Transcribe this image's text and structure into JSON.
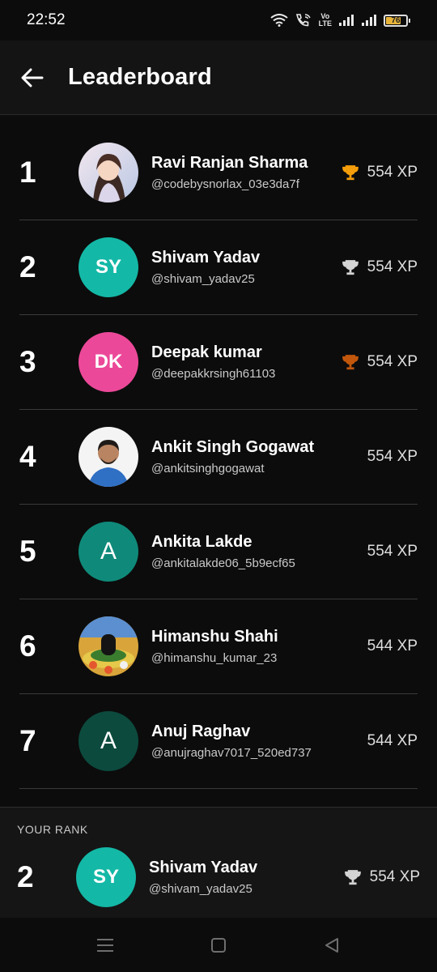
{
  "status_bar": {
    "time": "22:52",
    "volte_top": "Vo",
    "volte_bottom": "LTE",
    "battery": "76",
    "battery_level_percent": 76,
    "battery_color": "#e8b43a"
  },
  "app_bar": {
    "title": "Leaderboard",
    "back_icon": "arrow-left-icon"
  },
  "leaders": [
    {
      "rank": "1",
      "name": "Ravi Ranjan Sharma",
      "handle": "@codebysnorlax_03e3da7f",
      "xp": "554 XP",
      "avatar": "photo",
      "trophy": "gold"
    },
    {
      "rank": "2",
      "name": "Shivam Yadav",
      "handle": "@shivam_yadav25",
      "xp": "554 XP",
      "avatar": "SY",
      "avatar_color": "#14b8a6",
      "trophy": "silver"
    },
    {
      "rank": "3",
      "name": "Deepak kumar",
      "handle": "@deepakkrsingh61103",
      "xp": "554 XP",
      "avatar": "DK",
      "avatar_color": "#ec4899",
      "trophy": "bronze"
    },
    {
      "rank": "4",
      "name": "Ankit Singh Gogawat",
      "handle": "@ankitsinghgogawat",
      "xp": "554 XP",
      "avatar": "photo"
    },
    {
      "rank": "5",
      "name": "Ankita Lakde",
      "handle": "@ankitalakde06_5b9ecf65",
      "xp": "554 XP",
      "avatar": "A",
      "avatar_color": "#0f8a7a"
    },
    {
      "rank": "6",
      "name": "Himanshu Shahi",
      "handle": "@himanshu_kumar_23",
      "xp": "544 XP",
      "avatar": "photo"
    },
    {
      "rank": "7",
      "name": "Anuj Raghav",
      "handle": "@anujraghav7017_520ed737",
      "xp": "544 XP",
      "avatar": "A",
      "avatar_color": "#0c4a3e"
    }
  ],
  "your_rank": {
    "label": "YOUR RANK",
    "rank": "2",
    "name": "Shivam Yadav",
    "handle": "@shivam_yadav25",
    "xp": "554 XP",
    "avatar": "SY",
    "avatar_color": "#14b8a6",
    "trophy": "silver"
  },
  "trophy_colors": {
    "gold": "#f59e0b",
    "silver": "#d4d4d4",
    "bronze": "#c2570c"
  },
  "nav": {
    "recent_icon": "menu-lines-icon",
    "home_icon": "square-icon",
    "back_icon": "triangle-back-icon"
  }
}
